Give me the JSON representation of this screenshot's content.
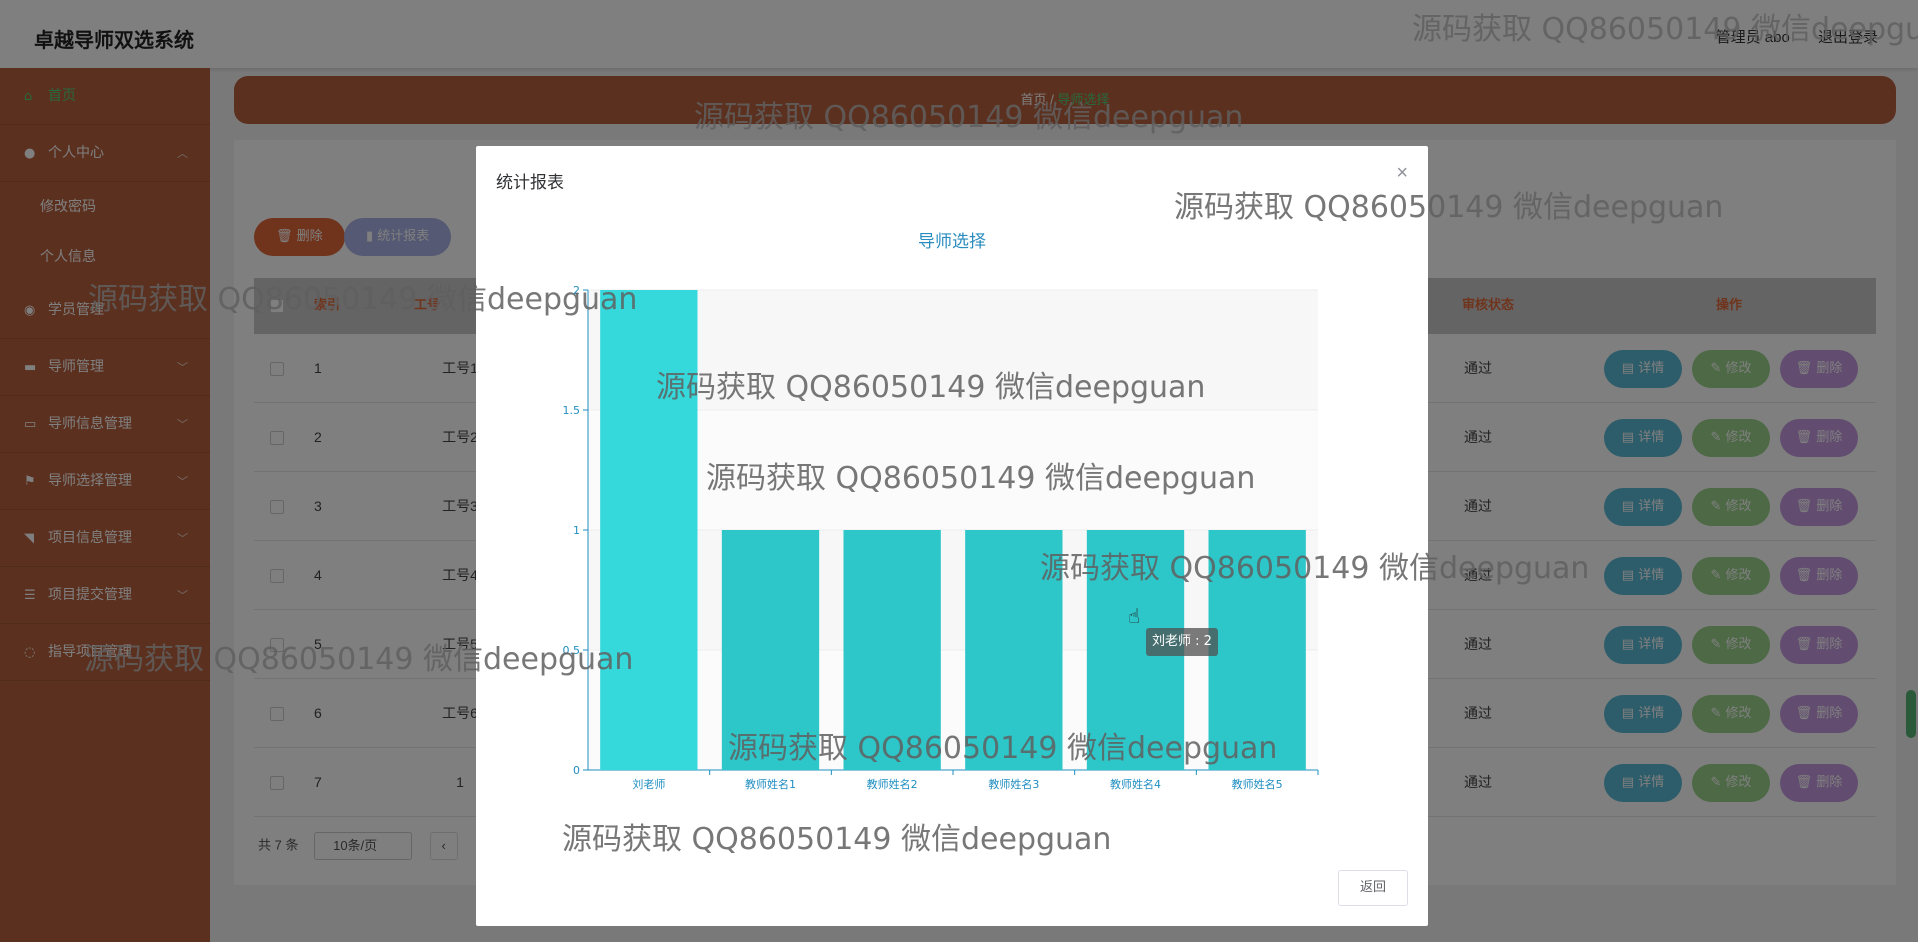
{
  "app": {
    "title": "卓越导师双选系统"
  },
  "header": {
    "user_label": "管理员 abo",
    "logout_label": "退出登录"
  },
  "sidebar": {
    "items": [
      {
        "label": "首页",
        "icon": "home-icon"
      },
      {
        "label": "个人中心",
        "icon": "user-icon"
      },
      {
        "label": "修改密码"
      },
      {
        "label": "个人信息"
      },
      {
        "label": "学员管理",
        "icon": "student-icon"
      },
      {
        "label": "导师管理",
        "icon": "teacher-icon"
      },
      {
        "label": "导师信息管理",
        "icon": "info-icon"
      },
      {
        "label": "导师选择管理",
        "icon": "flag-icon"
      },
      {
        "label": "项目信息管理",
        "icon": "project-icon"
      },
      {
        "label": "项目提交管理",
        "icon": "submit-icon"
      },
      {
        "label": "指导项目管理",
        "icon": "guide-icon"
      }
    ]
  },
  "breadcrumb": {
    "home": "首页",
    "current": "导师选择"
  },
  "toolbar": {
    "delete_label": "删除",
    "stat_label": "统计报表"
  },
  "table": {
    "headers": {
      "index": "索引",
      "worker_id": "工号",
      "status": "审核状态",
      "actions": "操作"
    },
    "rows": [
      {
        "index": "1",
        "worker_id": "工号1",
        "status": "通过"
      },
      {
        "index": "2",
        "worker_id": "工号2",
        "status": "通过"
      },
      {
        "index": "3",
        "worker_id": "工号3",
        "status": "通过"
      },
      {
        "index": "4",
        "worker_id": "工号4",
        "status": "通过"
      },
      {
        "index": "5",
        "worker_id": "工号5",
        "status": "通过"
      },
      {
        "index": "6",
        "worker_id": "工号6",
        "status": "通过"
      },
      {
        "index": "7",
        "worker_id": "1",
        "status": "通过"
      }
    ],
    "action_labels": {
      "detail": "详情",
      "edit": "修改",
      "delete": "删除"
    }
  },
  "pager": {
    "total": "共 7 条",
    "page_size": "10条/页"
  },
  "modal": {
    "title": "统计报表",
    "back_label": "返回",
    "tooltip": "刘老师 : 2"
  },
  "chart_data": {
    "type": "bar",
    "title": "导师选择",
    "categories": [
      "刘老师",
      "教师姓名1",
      "教师姓名2",
      "教师姓名3",
      "教师姓名4",
      "教师姓名5"
    ],
    "values": [
      2,
      1,
      1,
      1,
      1,
      1
    ],
    "ylim": [
      0,
      2
    ],
    "yticks": [
      "0",
      "0.5",
      "1",
      "1.5",
      "2"
    ],
    "bar_color": "#2ec7c9",
    "highlight_color": "#35d9dc",
    "grid": true
  },
  "watermark": "源码获取 QQ86050149 微信deepguan",
  "colors": {
    "sidebar": "#b8613f",
    "accent_green": "#4ed37b",
    "delete_btn": "#e0693b",
    "stat_btn": "#aab3e6"
  }
}
